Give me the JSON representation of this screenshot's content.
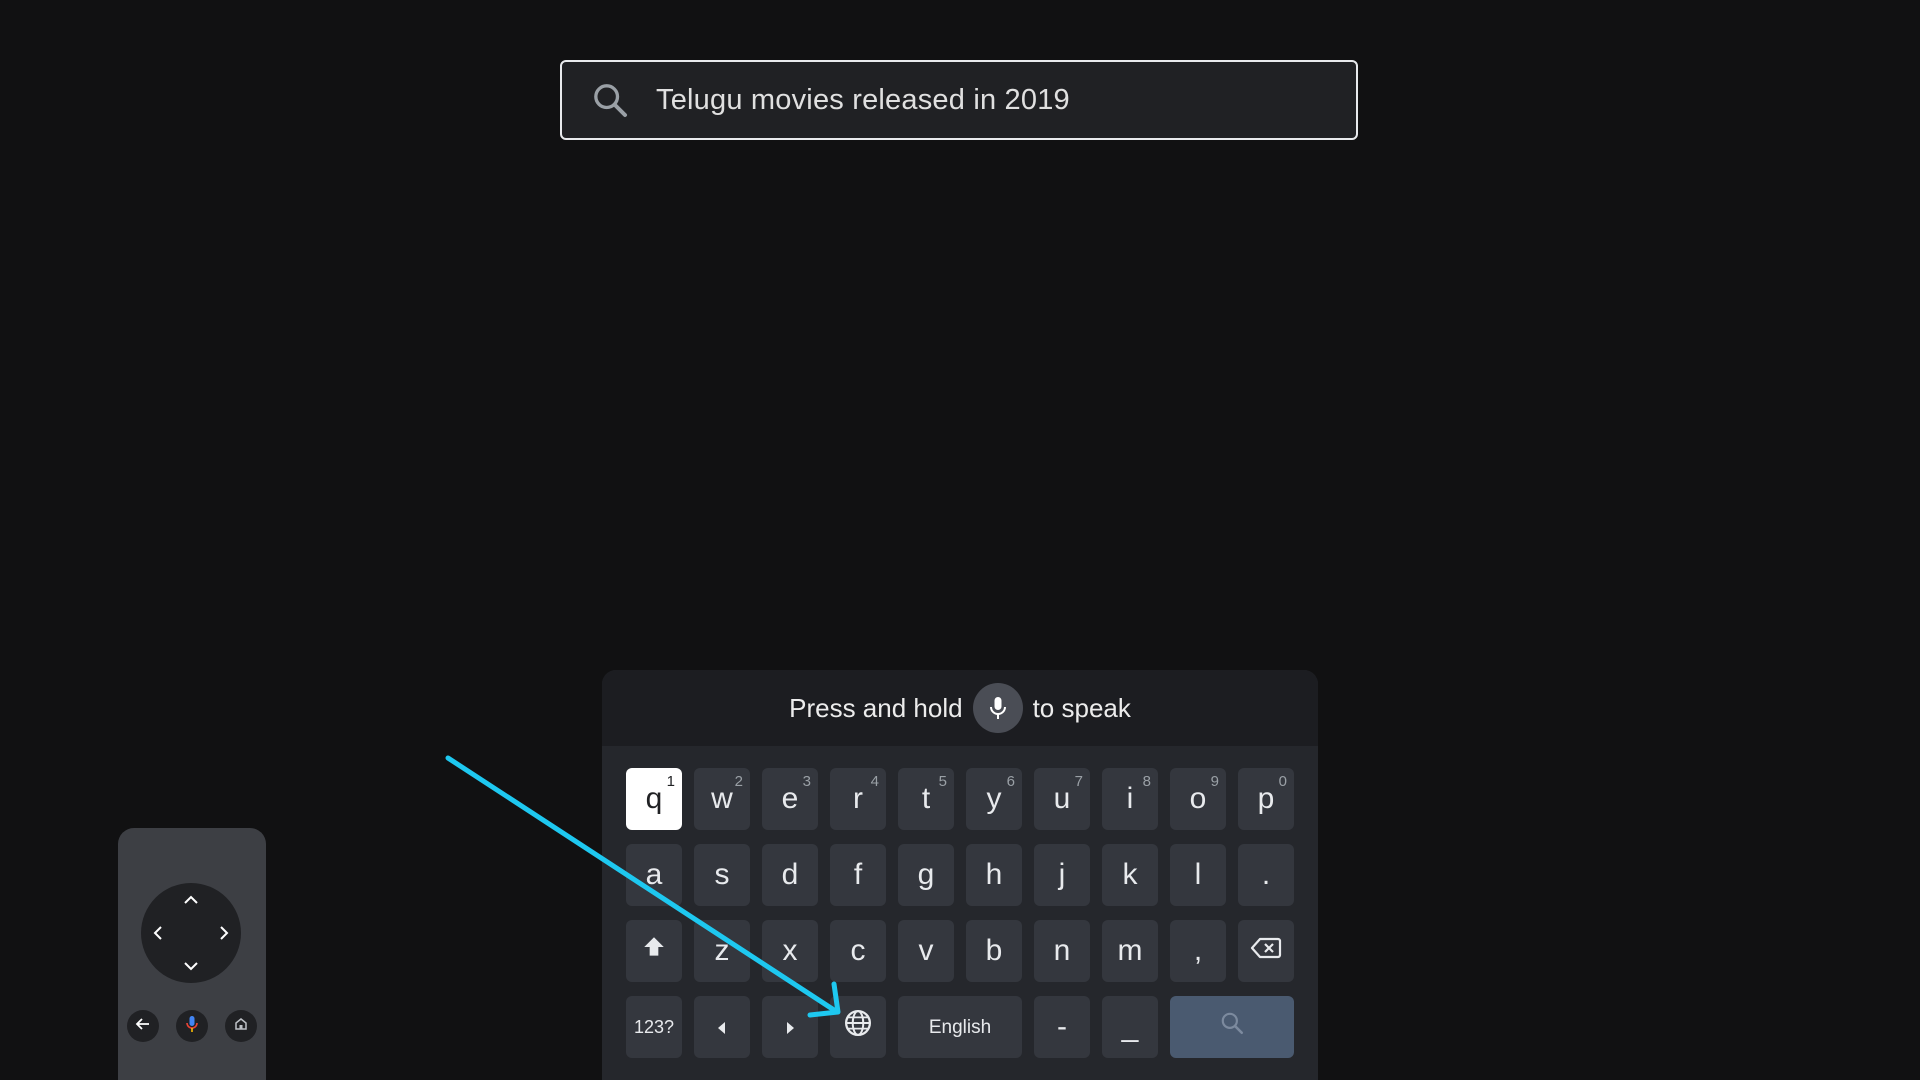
{
  "search": {
    "query": "Telugu movies released in 2019",
    "icon": "search-icon"
  },
  "keyboard": {
    "voice_hint": {
      "before": "Press and hold",
      "after": "to speak",
      "icon": "microphone-icon"
    },
    "row1": [
      {
        "key": "q",
        "alt": "1"
      },
      {
        "key": "w",
        "alt": "2"
      },
      {
        "key": "e",
        "alt": "3"
      },
      {
        "key": "r",
        "alt": "4"
      },
      {
        "key": "t",
        "alt": "5"
      },
      {
        "key": "y",
        "alt": "6"
      },
      {
        "key": "u",
        "alt": "7"
      },
      {
        "key": "i",
        "alt": "8"
      },
      {
        "key": "o",
        "alt": "9"
      },
      {
        "key": "p",
        "alt": "0"
      }
    ],
    "row2": [
      "a",
      "s",
      "d",
      "f",
      "g",
      "h",
      "j",
      "k",
      "l",
      "."
    ],
    "row3": [
      "z",
      "x",
      "c",
      "v",
      "b",
      "n",
      "m",
      ","
    ],
    "row4": {
      "symbols": "123?",
      "language": "English",
      "dash": "-",
      "underscore": "_"
    },
    "focused_key": "q",
    "icons": [
      "shift-icon",
      "backspace-icon",
      "cursor-left-icon",
      "cursor-right-icon",
      "globe-icon",
      "search-icon"
    ]
  },
  "annotation": {
    "arrow_color": "#1ec8f0",
    "points_to": "globe-key"
  },
  "remote": {
    "icons": [
      "chevron-up-icon",
      "chevron-down-icon",
      "chevron-left-icon",
      "chevron-right-icon",
      "back-arrow-icon",
      "microphone-icon",
      "home-icon"
    ]
  }
}
